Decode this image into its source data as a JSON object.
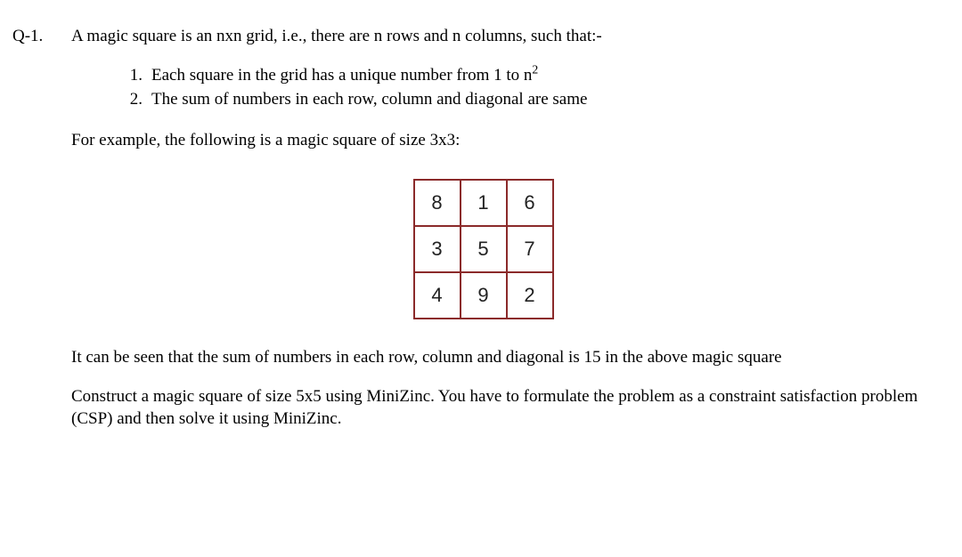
{
  "question_label": "Q-1.",
  "intro": "A magic square is an nxn grid, i.e., there are n rows and n columns, such that:-",
  "list": {
    "items": [
      {
        "num": "1.",
        "text_html": "Each square in the grid has a unique number from 1 to n<sup>2</sup>"
      },
      {
        "num": "2.",
        "text_html": "The sum of numbers in each row, column and diagonal are same"
      }
    ]
  },
  "example_line": "For example, the following is a magic square of size 3x3:",
  "magic_square": {
    "rows": [
      [
        "8",
        "1",
        "6"
      ],
      [
        "3",
        "5",
        "7"
      ],
      [
        "4",
        "9",
        "2"
      ]
    ]
  },
  "seen_line": "It can be seen that the sum of numbers in each row, column and diagonal is 15 in the above magic square",
  "construct_line": "Construct a magic square of size 5x5 using MiniZinc. You have to formulate the problem as a constraint satisfaction problem (CSP) and then solve it using MiniZinc."
}
